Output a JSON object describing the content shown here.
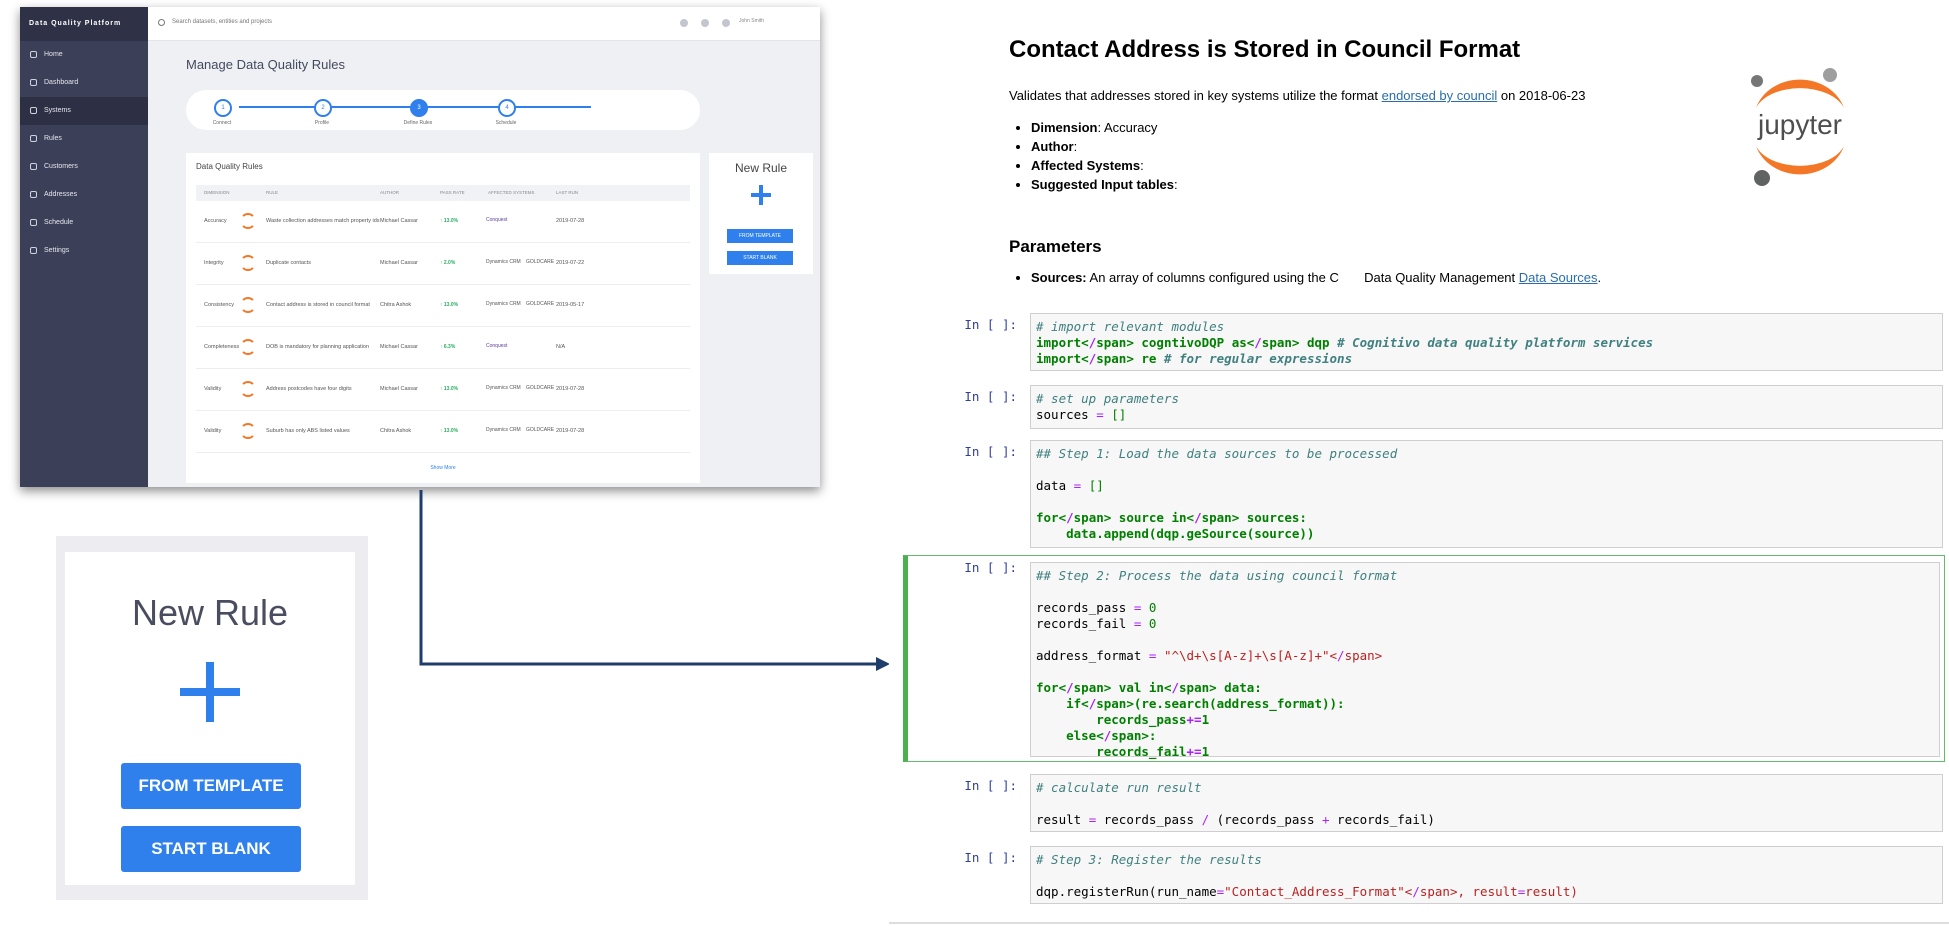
{
  "app": {
    "brand": "Data Quality Platform",
    "search_placeholder": "Search datasets, entities and projects",
    "user_name": "John Smith",
    "nav": [
      {
        "label": "Home",
        "icon": "home-icon"
      },
      {
        "label": "Dashboard",
        "icon": "bar-chart-icon"
      },
      {
        "label": "Systems",
        "icon": "database-icon"
      },
      {
        "label": "Rules",
        "icon": "rules-icon"
      },
      {
        "label": "Customers",
        "icon": "user-icon"
      },
      {
        "label": "Addresses",
        "icon": "map-pin-icon"
      },
      {
        "label": "Schedule",
        "icon": "calendar-icon"
      },
      {
        "label": "Settings",
        "icon": "gear-icon"
      }
    ],
    "page_title": "Manage Data Quality Rules",
    "steps": [
      {
        "num": "1",
        "label": "Connect"
      },
      {
        "num": "2",
        "label": "Profile"
      },
      {
        "num": "3",
        "label": "Define Rules"
      },
      {
        "num": "4",
        "label": "Schedule"
      }
    ],
    "table": {
      "title": "Data Quality Rules",
      "headers": [
        "DIMENSION",
        "RULE",
        "AUTHOR",
        "PASS RATE",
        "AFFECTED SYSTEMS",
        "LAST RUN"
      ],
      "rows": [
        {
          "dimension": "Accuracy",
          "rule": "Waste collection addresses match property ids",
          "author": "Michael Cassar",
          "pass": "↑ 13.0%",
          "systems": [
            "Conquest"
          ],
          "last_run": "2019-07-28"
        },
        {
          "dimension": "Integrity",
          "rule": "Duplicate contacts",
          "author": "Michael Cassar",
          "pass": "↑ 2.0%",
          "systems": [
            "Dynamics CRM",
            "GOLDCARE"
          ],
          "last_run": "2019-07-22"
        },
        {
          "dimension": "Consistency",
          "rule": "Contact address is stored in council format",
          "author": "Chitra Ashok",
          "pass": "↑ 13.0%",
          "systems": [
            "Dynamics CRM",
            "GOLDCARE"
          ],
          "last_run": "2019-05-17"
        },
        {
          "dimension": "Completeness",
          "rule": "DOB is mandatory for planning application",
          "author": "Michael Cassar",
          "pass": "↑ 6.3%",
          "systems": [
            "Conquest"
          ],
          "last_run": "N/A"
        },
        {
          "dimension": "Validity",
          "rule": "Address postcodes have four digits",
          "author": "Michael Cassar",
          "pass": "↑ 13.0%",
          "systems": [
            "Dynamics CRM",
            "GOLDCARE"
          ],
          "last_run": "2019-07-28"
        },
        {
          "dimension": "Validity",
          "rule": "Suburb has only ABS listed values",
          "author": "Chitra Ashok",
          "pass": "↑ 13.0%",
          "systems": [
            "Dynamics CRM",
            "GOLDCARE"
          ],
          "last_run": "2019-07-28"
        }
      ],
      "show_more": "Show More"
    }
  },
  "new_rule": {
    "title": "New Rule",
    "from_template": "FROM TEMPLATE",
    "start_blank": "START BLANK"
  },
  "notebook": {
    "title": "Contact Address is Stored in Council Format",
    "desc_prefix": "Validates that addresses stored in key systems utilize the format ",
    "desc_link": "endorsed by council",
    "desc_suffix": " on 2018-06-23",
    "meta": [
      {
        "key": "Dimension",
        "value": ": Accuracy"
      },
      {
        "key": "Author",
        "value": ":"
      },
      {
        "key": "Affected Systems",
        "value": ":"
      },
      {
        "key": "Suggested Input tables",
        "value": ":"
      }
    ],
    "params_heading": "Parameters",
    "sources_key": "Sources:",
    "sources_text": " An array of columns configured using the C       Data Quality Management ",
    "sources_link": "Data Sources",
    "sources_end": ".",
    "logo_text": "jupyter",
    "prompt": "In [ ]:",
    "cells": [
      "# import relevant modules\nimport cogntivoDQP as dqp # Cognitivo data quality platform services\nimport re # for regular expressions",
      "# set up parameters\nsources = []",
      "## Step 1: Load the data sources to be processed\n\ndata = []\n\nfor source in sources:\n    data.append(dqp.geSource(source))",
      "## Step 2: Process the data using council format\n\nrecords_pass = 0\nrecords_fail = 0\n\naddress_format = \"^\\d+\\s[A-z]+\\s[A-z]+\"\n\nfor val in data:\n    if(re.search(address_format)):\n        records_pass+=1\n    else:\n        records_fail+=1",
      "# calculate run result\n\nresult = records_pass / (records_pass + records_fail)",
      "# Step 3: Register the results\n\ndqp.registerRun(run_name=\"Contact_Address_Format\", result=result)"
    ]
  },
  "colors": {
    "accent": "#2f80ed",
    "sidebar": "#3c3f58",
    "jupyter_orange": "#f37726",
    "selected_cell": "#4caf50",
    "arrow": "#1f3d6b"
  }
}
